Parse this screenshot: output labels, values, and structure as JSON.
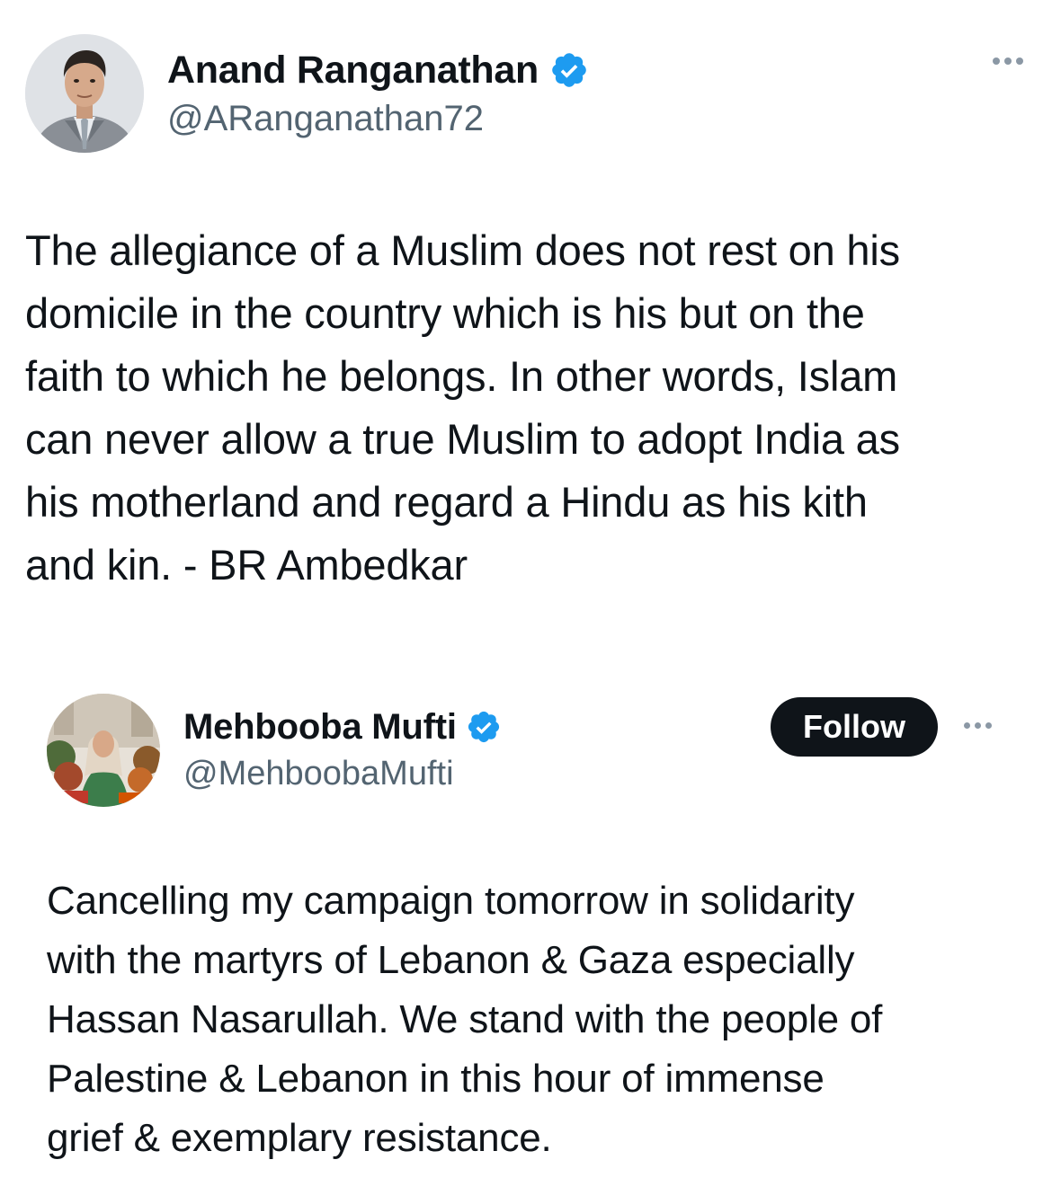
{
  "main_tweet": {
    "author_name": "Anand Ranganathan",
    "handle": "@ARanganathan72",
    "verified": true,
    "text_lines": [
      "The allegiance of a Muslim does not rest on his",
      "domicile in the country which is his but on the",
      "faith to which he belongs. In other words, Islam",
      "can never allow a true Muslim to adopt India as",
      "his motherland and regard a Hindu as his kith",
      "and kin. - BR Ambedkar"
    ],
    "icons": {
      "avatar": "profile-photo",
      "badge": "verified-badge-icon",
      "menu": "more-options-icon"
    }
  },
  "quoted_tweet": {
    "author_name": "Mehbooba Mufti",
    "handle": "@MehboobaMufti",
    "verified": true,
    "follow_label": "Follow",
    "text_lines": [
      "Cancelling my campaign tomorrow in solidarity",
      "with the martyrs of Lebanon & Gaza especially",
      "Hassan Nasarullah. We stand with the people of",
      "Palestine & Lebanon in this hour of immense",
      "grief & exemplary resistance."
    ],
    "icons": {
      "avatar": "profile-photo",
      "badge": "verified-badge-icon",
      "menu": "more-options-icon"
    }
  },
  "colors": {
    "text_primary": "#0f1419",
    "text_secondary": "#536471",
    "verified_blue": "#1d9bf0",
    "follow_button_bg": "#0f1419",
    "follow_button_text": "#ffffff",
    "background": "#ffffff"
  }
}
